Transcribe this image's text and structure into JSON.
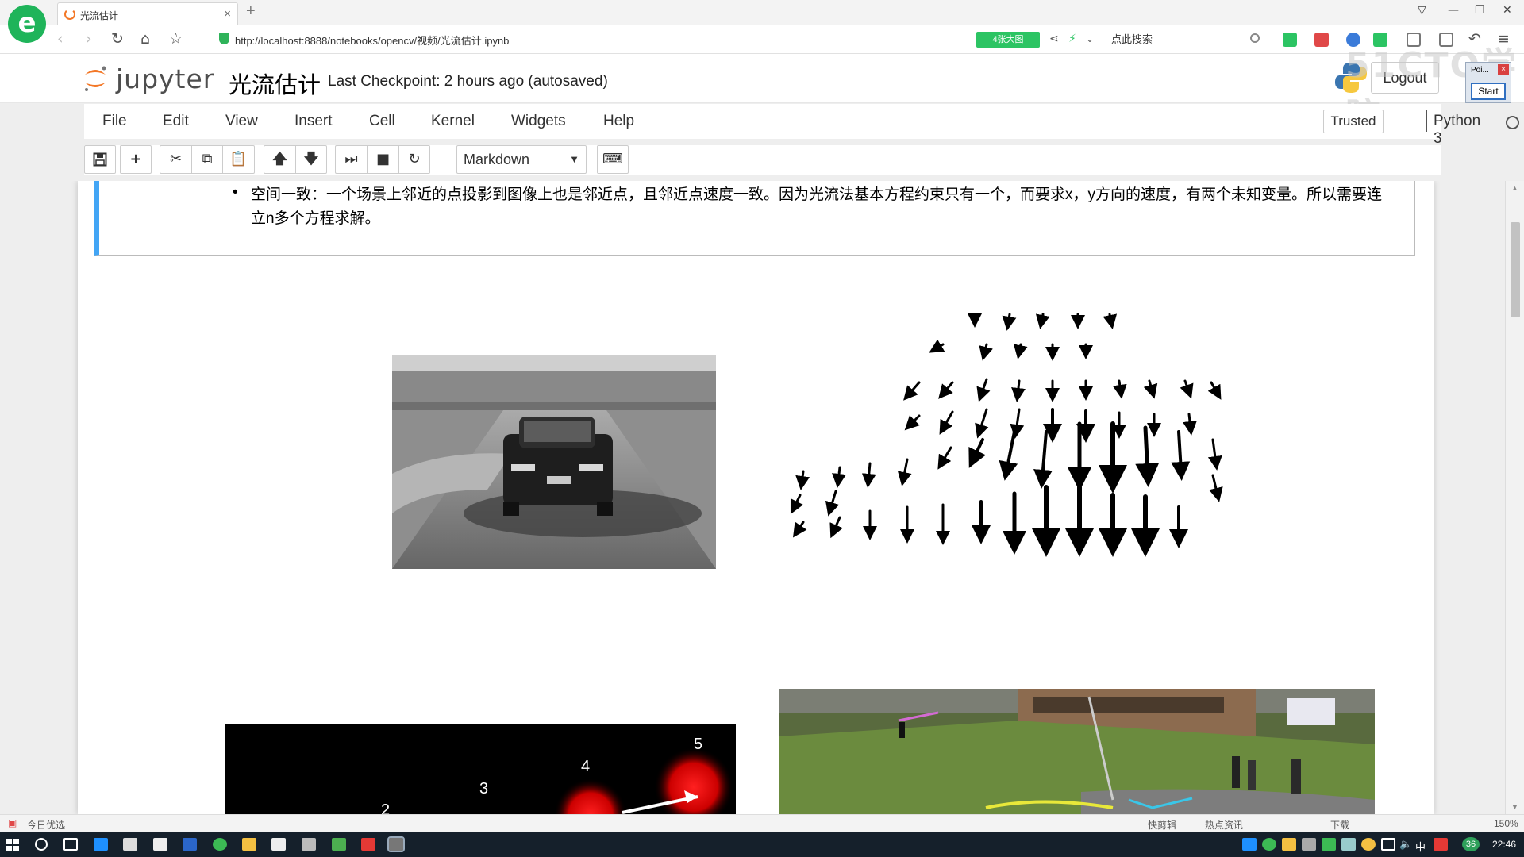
{
  "browser": {
    "logo_glyph": "e",
    "tab_title": "光流估计",
    "tab_close": "×",
    "new_tab": "+",
    "url": "http://localhost:8888/notebooks/opencv/视频/光流估计.ipynb",
    "badge": "4张大图",
    "search_placeholder": "点此搜索"
  },
  "jupyter": {
    "logo_text": "jupyter",
    "notebook_name": "光流估计",
    "checkpoint": "Last Checkpoint: 2 hours ago (autosaved)",
    "logout": "Logout",
    "menu": [
      "File",
      "Edit",
      "View",
      "Insert",
      "Cell",
      "Kernel",
      "Widgets",
      "Help"
    ],
    "trusted": "Trusted",
    "kernel": "Python 3",
    "cell_type": "Markdown"
  },
  "overlay": {
    "watermark": "51CTO学院",
    "popup_title": "Poi...",
    "popup_close": "×",
    "popup_button": "Start"
  },
  "notebook": {
    "bullet_text": "空间一致：一个场景上邻近的点投影到图像上也是邻近点，且邻近点速度一致。因为光流法基本方程约束只有一个，而要求x，y方向的速度，有两个未知变量。所以需要连立n多个方程求解。",
    "dot_labels": [
      "2",
      "3",
      "4",
      "5"
    ]
  },
  "status": {
    "left_text": "今日优选",
    "right_items": [
      "快剪辑",
      "热点资讯",
      "下载",
      "150%"
    ]
  },
  "taskbar": {
    "time": "22:46",
    "ime": "中",
    "badge": "36"
  },
  "colors": {
    "accent_blue": "#42a5f5",
    "jupyter_orange": "#f37726",
    "browser_green": "#1fb45a"
  }
}
